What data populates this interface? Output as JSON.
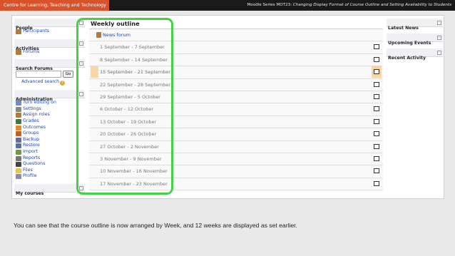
{
  "topbar": {
    "brand": "Centre for Learning, Teaching and Technology",
    "series": "Moodle Series MOT23:",
    "series_title": "Changing Display Format of Course Outline and Setting Availability to Students"
  },
  "left": {
    "people": {
      "title": "People",
      "items": [
        "Participants"
      ]
    },
    "activities": {
      "title": "Activities",
      "items": [
        "Forums"
      ]
    },
    "search": {
      "title": "Search Forums",
      "go": "Go",
      "advanced": "Advanced search",
      "help": "?"
    },
    "admin": {
      "title": "Administration",
      "items": [
        "Turn editing on",
        "Settings",
        "Assign roles",
        "Grades",
        "Outcomes",
        "Groups",
        "Backup",
        "Restore",
        "Import",
        "Reports",
        "Questions",
        "Files",
        "Profile"
      ]
    },
    "mycourses": {
      "title": "My courses"
    }
  },
  "outline": {
    "title": "Weekly outline",
    "news": "News forum",
    "weeks": [
      "1 September - 7 September",
      "8 September - 14 September",
      "15 September - 21 September",
      "22 September - 28 September",
      "29 September - 5 October",
      "6 October - 12 October",
      "13 October - 19 October",
      "20 October - 26 October",
      "27 October - 2 November",
      "3 November - 9 November",
      "10 November - 16 November",
      "17 November - 23 November"
    ],
    "current_week_index": 2
  },
  "right": {
    "blocks": [
      "Latest News",
      "Upcoming Events",
      "Recent Activity"
    ]
  },
  "caption": "You can see that the course outline is now arranged by Week, and 12 weeks are displayed as set earlier.",
  "colors": {
    "brand": "#d9532a",
    "highlight": "#47d047",
    "current": "#f6d7a3",
    "link": "#1d46b8"
  },
  "icons": {
    "people": [
      "participants-icon"
    ],
    "activities": [
      "forums-icon"
    ],
    "admin": [
      "turn-editing-on-icon",
      "settings-icon",
      "assign-roles-icon",
      "grades-icon",
      "outcomes-icon",
      "groups-icon",
      "backup-icon",
      "restore-icon",
      "import-icon",
      "reports-icon",
      "questions-icon",
      "files-icon",
      "profile-icon"
    ]
  }
}
